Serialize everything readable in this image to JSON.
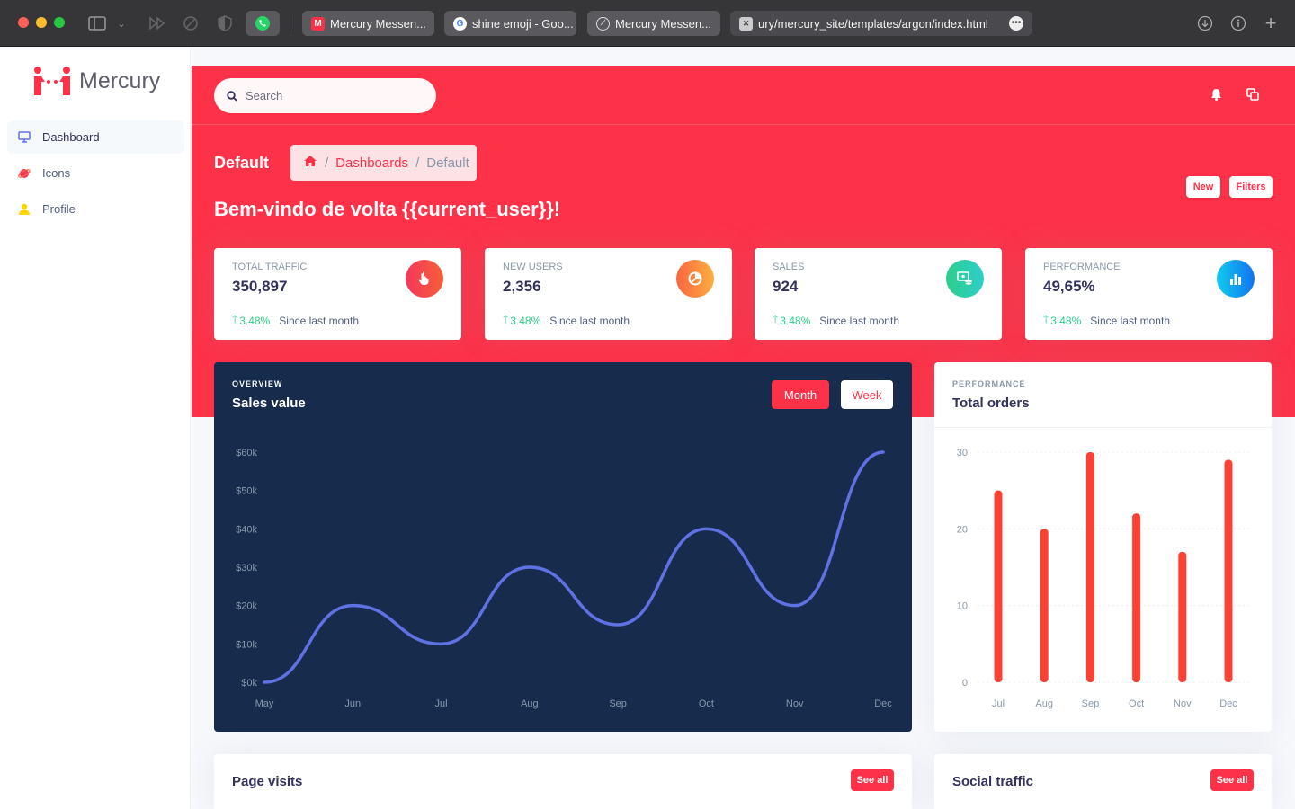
{
  "browser": {
    "tabs": [
      {
        "label": "Mercury Messen..."
      },
      {
        "label": "shine emoji - Goo..."
      },
      {
        "label": "Mercury Messen..."
      }
    ],
    "url": "ury/mercury_site/templates/argon/index.html"
  },
  "brand": {
    "name": "Mercury",
    "color": "#fd3248"
  },
  "sidebar": {
    "items": [
      {
        "label": "Dashboard",
        "icon": "tv-icon",
        "active": true
      },
      {
        "label": "Icons",
        "icon": "planet-icon"
      },
      {
        "label": "Profile",
        "icon": "user-icon"
      }
    ]
  },
  "header": {
    "search_placeholder": "Search",
    "page_title": "Default",
    "breadcrumb": [
      "Dashboards",
      "Default"
    ],
    "welcome": "Bem-vindo de volta {{current_user}}!",
    "new_label": "New",
    "filters_label": "Filters"
  },
  "stats": [
    {
      "label": "Total traffic",
      "value": "350,897",
      "change": "3.48%",
      "since": "Since last month",
      "color": "#f5365c"
    },
    {
      "label": "New users",
      "value": "2,356",
      "change": "3.48%",
      "since": "Since last month",
      "color": "#fb6340"
    },
    {
      "label": "Sales",
      "value": "924",
      "change": "3.48%",
      "since": "Since last month",
      "color": "#2dce89"
    },
    {
      "label": "Performance",
      "value": "49,65%",
      "change": "3.48%",
      "since": "Since last month",
      "color": "#11cdef"
    }
  ],
  "sales_card": {
    "overline": "OVERVIEW",
    "title": "Sales value",
    "month_label": "Month",
    "week_label": "Week"
  },
  "orders_card": {
    "overline": "PERFORMANCE",
    "title": "Total orders"
  },
  "bottom": {
    "page_visits": {
      "title": "Page visits",
      "button": "See all"
    },
    "social_traffic": {
      "title": "Social traffic",
      "button": "See all"
    }
  },
  "chart_data": [
    {
      "type": "line",
      "title": "Sales value",
      "categories": [
        "May",
        "Jun",
        "Jul",
        "Aug",
        "Sep",
        "Oct",
        "Nov",
        "Dec"
      ],
      "values": [
        0,
        20,
        10,
        30,
        15,
        40,
        20,
        60
      ],
      "ytick_labels": [
        "$0k",
        "$10k",
        "$20k",
        "$30k",
        "$40k",
        "$50k",
        "$60k"
      ],
      "ylim": [
        0,
        60
      ],
      "grid": false,
      "line_color": "#5e72e4"
    },
    {
      "type": "bar",
      "title": "Total orders",
      "categories": [
        "Jul",
        "Aug",
        "Sep",
        "Oct",
        "Nov",
        "Dec"
      ],
      "values": [
        25,
        20,
        30,
        22,
        17,
        29
      ],
      "yticks": [
        0,
        10,
        20,
        30
      ],
      "ylim": [
        0,
        30
      ],
      "grid": true,
      "bar_color": "#fb4133"
    }
  ]
}
